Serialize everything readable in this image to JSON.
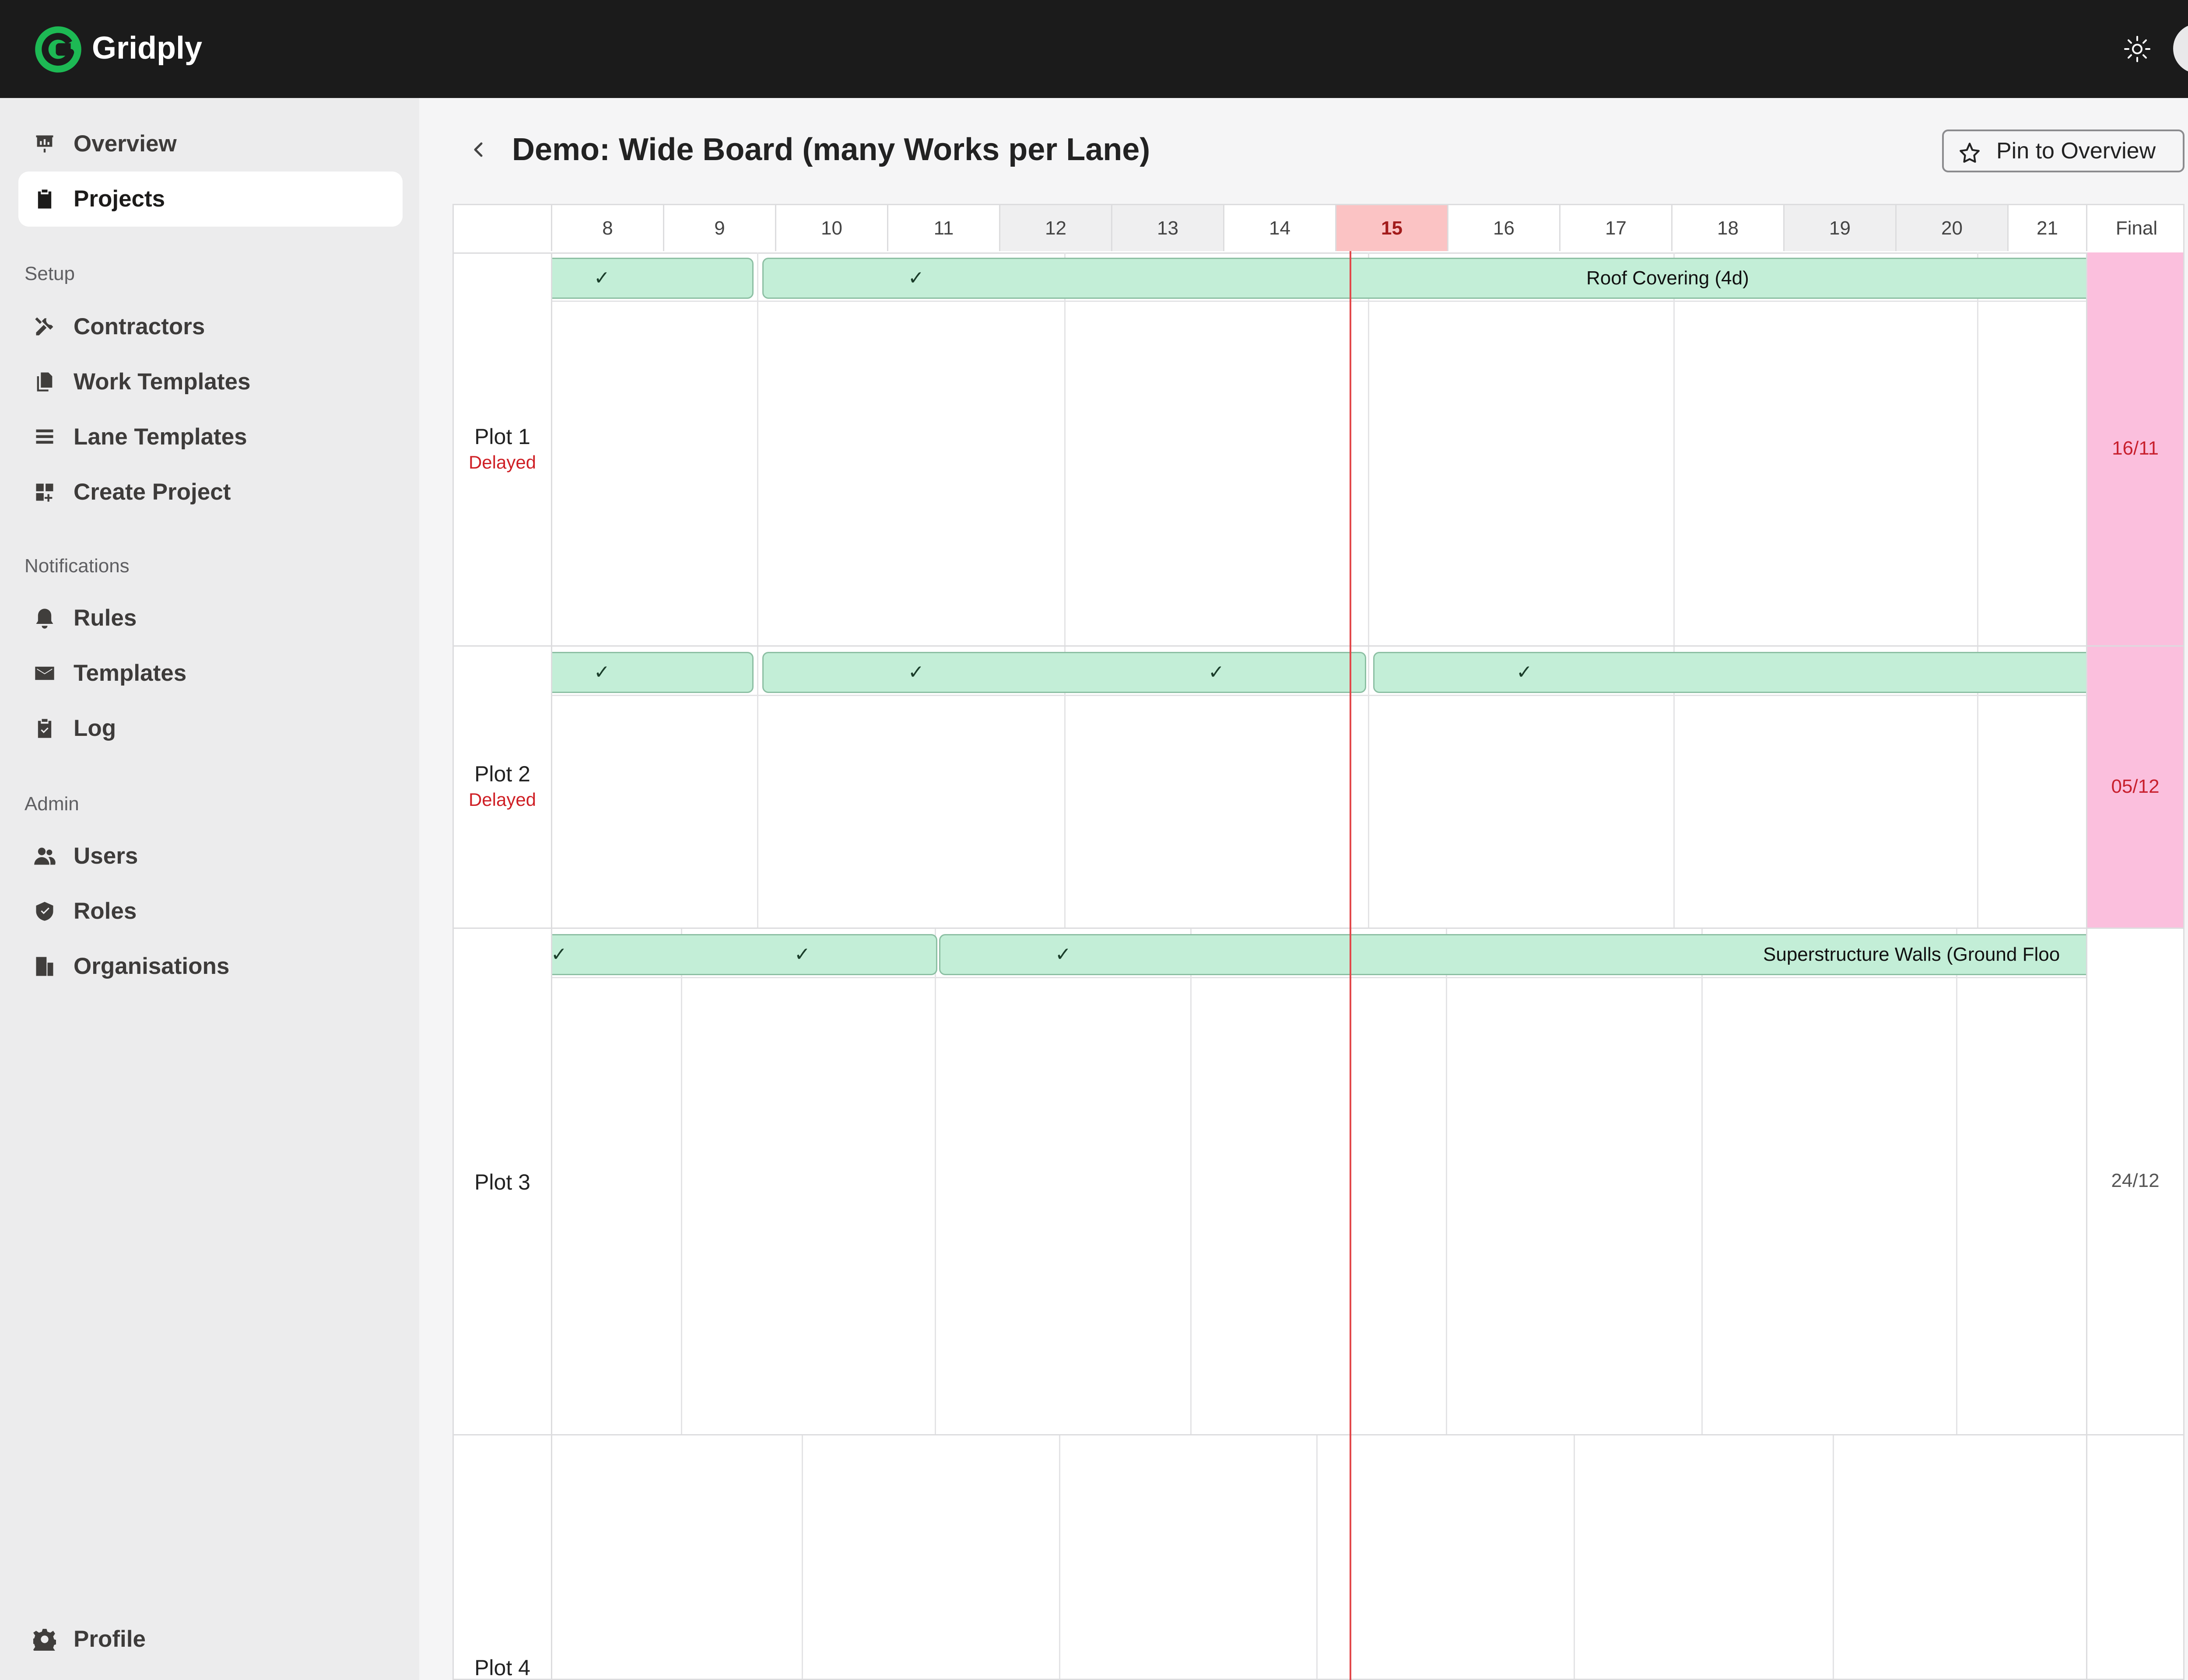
{
  "app": {
    "brand": "Gridply",
    "colors": {
      "brand_green": "#1db954",
      "header_bg": "#1b1b1b",
      "today": "#e2484b",
      "bar": "#c3eed7",
      "late_final": "#fbbfdd"
    }
  },
  "sidebar": {
    "top_items": [
      {
        "label": "Overview",
        "icon": "presentation-chart-icon"
      },
      {
        "label": "Projects",
        "icon": "clipboard-icon",
        "active": true
      }
    ],
    "sections": [
      {
        "title": "Setup",
        "items": [
          {
            "label": "Contractors",
            "icon": "tools-icon"
          },
          {
            "label": "Work Templates",
            "icon": "documents-icon"
          },
          {
            "label": "Lane Templates",
            "icon": "lines-icon"
          },
          {
            "label": "Create Project",
            "icon": "grid-plus-icon"
          }
        ]
      },
      {
        "title": "Notifications",
        "items": [
          {
            "label": "Rules",
            "icon": "bell-icon"
          },
          {
            "label": "Templates",
            "icon": "envelope-icon"
          },
          {
            "label": "Log",
            "icon": "clipboard-check-icon"
          }
        ]
      },
      {
        "title": "Admin",
        "items": [
          {
            "label": "Users",
            "icon": "users-icon"
          },
          {
            "label": "Roles",
            "icon": "shield-icon"
          },
          {
            "label": "Organisations",
            "icon": "building-icon"
          }
        ]
      }
    ],
    "profile": {
      "label": "Profile",
      "icon": "gear-icon"
    }
  },
  "page": {
    "title": "Demo: Wide Board (many Works per Lane)",
    "pin_label": "Pin to Overview"
  },
  "board": {
    "days": [
      "8",
      "9",
      "10",
      "11",
      "12",
      "13",
      "14",
      "15",
      "16",
      "17",
      "18",
      "19",
      "20",
      "21"
    ],
    "weekend_days": [
      "12",
      "13",
      "19",
      "20"
    ],
    "today": "15",
    "final_header": "Final",
    "lanes": [
      {
        "name": "Plot 1",
        "status": "Delayed",
        "final": "16/11",
        "final_late": true,
        "bars": [
          {
            "check": "✓",
            "label": ""
          },
          {
            "check": "✓",
            "label": "Roof Covering (4d)"
          }
        ]
      },
      {
        "name": "Plot 2",
        "status": "Delayed",
        "final": "05/12",
        "final_late": true,
        "bars": [
          {
            "check": "✓",
            "label": ""
          },
          {
            "check": "✓",
            "label": ""
          },
          {
            "check": "✓",
            "label": ""
          },
          {
            "check": "✓",
            "label": ""
          }
        ]
      },
      {
        "name": "Plot 3",
        "status": "",
        "final": "24/12",
        "final_late": false,
        "bars": [
          {
            "check": "✓",
            "label": ""
          },
          {
            "check": "✓",
            "label": ""
          },
          {
            "check": "✓",
            "label": "Superstructure Walls (Ground Floo"
          }
        ]
      },
      {
        "name": "Plot 4",
        "status": "",
        "final": "",
        "final_late": false,
        "bars": []
      }
    ]
  }
}
